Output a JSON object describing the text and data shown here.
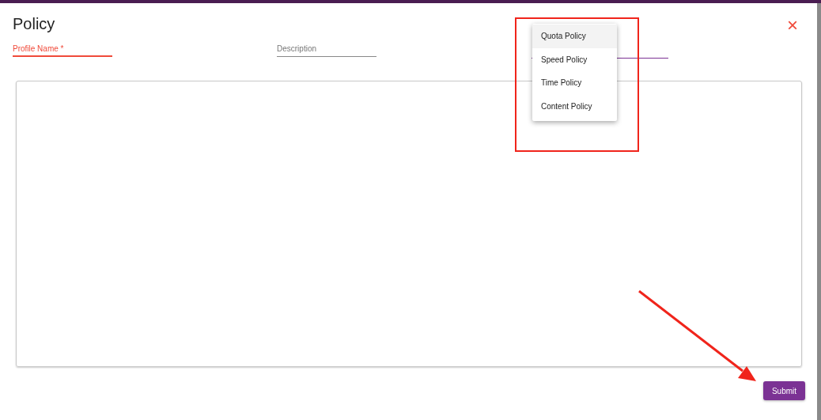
{
  "dialog": {
    "title": "Policy",
    "close_icon": "×"
  },
  "fields": [
    {
      "kind": "text",
      "label": "Profile Name *",
      "invalid": true
    },
    {
      "kind": "text",
      "label": "Description",
      "invalid": false
    },
    {
      "kind": "select",
      "expanded": true,
      "options": [
        {
          "label": "Quota Policy",
          "selected": true
        },
        {
          "label": "Speed Policy",
          "selected": false
        },
        {
          "label": "Time Policy",
          "selected": false
        },
        {
          "label": "Content Policy",
          "selected": false
        }
      ]
    }
  ],
  "submit_button": "Submit"
}
